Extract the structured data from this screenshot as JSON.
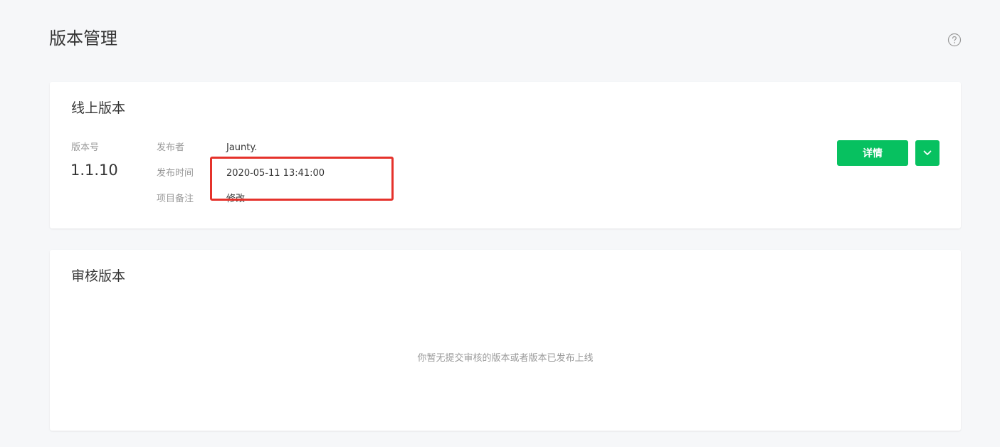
{
  "page": {
    "title": "版本管理"
  },
  "icons": {
    "help": "help-circle-icon",
    "more": "chevron-down-icon"
  },
  "colors": {
    "accent": "#07c160",
    "highlight": "#e5322b"
  },
  "online_version": {
    "title": "线上版本",
    "version_label": "版本号",
    "version_number": "1.1.10",
    "publisher_label": "发布者",
    "publisher": "Jaunty.",
    "publish_time_label": "发布时间",
    "publish_time": "2020-05-11 13:41:00",
    "remark_label": "项目备注",
    "remark": "修改",
    "detail_button": "详情"
  },
  "review_version": {
    "title": "审核版本",
    "empty_message": "你暂无提交审核的版本或者版本已发布上线"
  }
}
